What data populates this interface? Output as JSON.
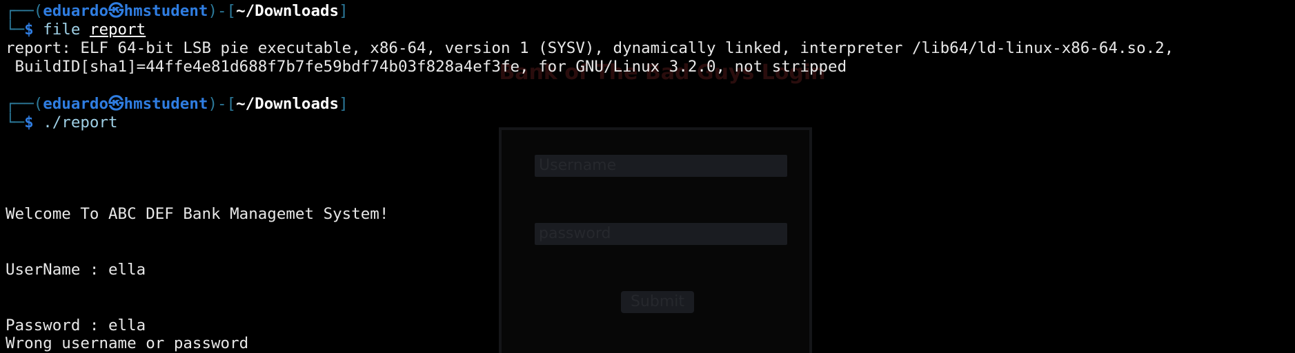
{
  "ghost_page": {
    "title": "Bank of The Bad Guys Login",
    "username_placeholder": "Username",
    "password_placeholder": "password",
    "submit_label": "Submit"
  },
  "terminal": {
    "prompt": {
      "user": "eduardo",
      "sep": "㉿",
      "host": "hmstudent",
      "cwd": "~/Downloads"
    },
    "commands": [
      {
        "program": "file",
        "argument": "report"
      },
      {
        "program": "./report",
        "argument": ""
      }
    ],
    "output": {
      "file_line1": "report: ELF 64-bit LSB pie executable, x86-64, version 1 (SYSV), dynamically linked, interpreter /lib64/ld-linux-x86-64.so.2,",
      "file_line2": " BuildID[sha1]=44ffe4e81d688f7b7fe59bdf74b03f828a4ef3fe, for GNU/Linux 3.2.0, not stripped",
      "welcome": "Welcome To ABC DEF Bank Managemet System!",
      "username_prompt": "UserName : ella",
      "password_prompt": "Password : ella",
      "error": "Wrong username or password"
    }
  }
}
